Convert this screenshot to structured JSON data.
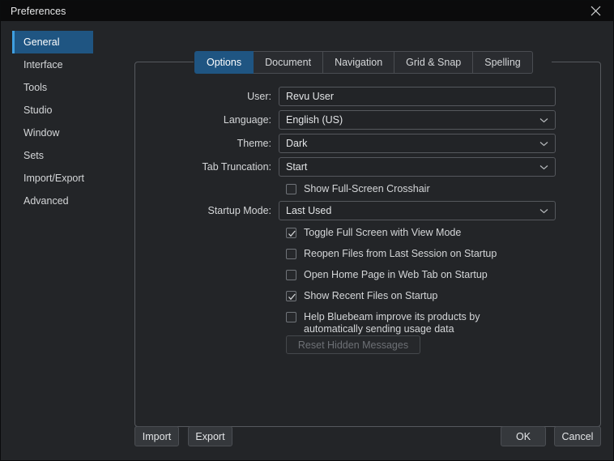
{
  "window": {
    "title": "Preferences",
    "close_icon": "close-icon"
  },
  "sidebar": {
    "items": [
      {
        "label": "General",
        "selected": true
      },
      {
        "label": "Interface",
        "selected": false
      },
      {
        "label": "Tools",
        "selected": false
      },
      {
        "label": "Studio",
        "selected": false
      },
      {
        "label": "Window",
        "selected": false
      },
      {
        "label": "Sets",
        "selected": false
      },
      {
        "label": "Import/Export",
        "selected": false
      },
      {
        "label": "Advanced",
        "selected": false
      }
    ]
  },
  "tabs": [
    {
      "label": "Options",
      "active": true
    },
    {
      "label": "Document",
      "active": false
    },
    {
      "label": "Navigation",
      "active": false
    },
    {
      "label": "Grid & Snap",
      "active": false
    },
    {
      "label": "Spelling",
      "active": false
    }
  ],
  "form": {
    "user": {
      "label": "User:",
      "value": "Revu User",
      "placeholder": ""
    },
    "language": {
      "label": "Language:",
      "value": "English (US)",
      "chevron_icon": "chevron-down-icon"
    },
    "theme": {
      "label": "Theme:",
      "value": "Dark",
      "chevron_icon": "chevron-down-icon"
    },
    "tab_truncation": {
      "label": "Tab Truncation:",
      "value": "Start",
      "chevron_icon": "chevron-down-icon"
    },
    "startup_mode": {
      "label": "Startup Mode:",
      "value": "Last Used",
      "chevron_icon": "chevron-down-icon"
    }
  },
  "checkboxes": [
    {
      "label": "Show Full-Screen Crosshair",
      "checked": false
    },
    {
      "label": "Toggle Full Screen with View Mode",
      "checked": true
    },
    {
      "label": "Reopen Files from Last Session on Startup",
      "checked": false
    },
    {
      "label": "Open Home Page in Web Tab on Startup",
      "checked": false
    },
    {
      "label": "Show Recent Files on Startup",
      "checked": true
    },
    {
      "label": "Help Bluebeam improve its products by automatically sending usage data",
      "checked": false
    }
  ],
  "reset_button": {
    "label": "Reset Hidden Messages",
    "enabled": false
  },
  "footer": {
    "import_label": "Import",
    "export_label": "Export",
    "ok_label": "OK",
    "cancel_label": "Cancel"
  },
  "colors": {
    "window_bg": "#232528",
    "titlebar_bg": "#0b0b0c",
    "accent": "#1f5582",
    "accent_bar": "#3f9fe0",
    "text": "#d4d6d8",
    "border": "#56595e"
  }
}
